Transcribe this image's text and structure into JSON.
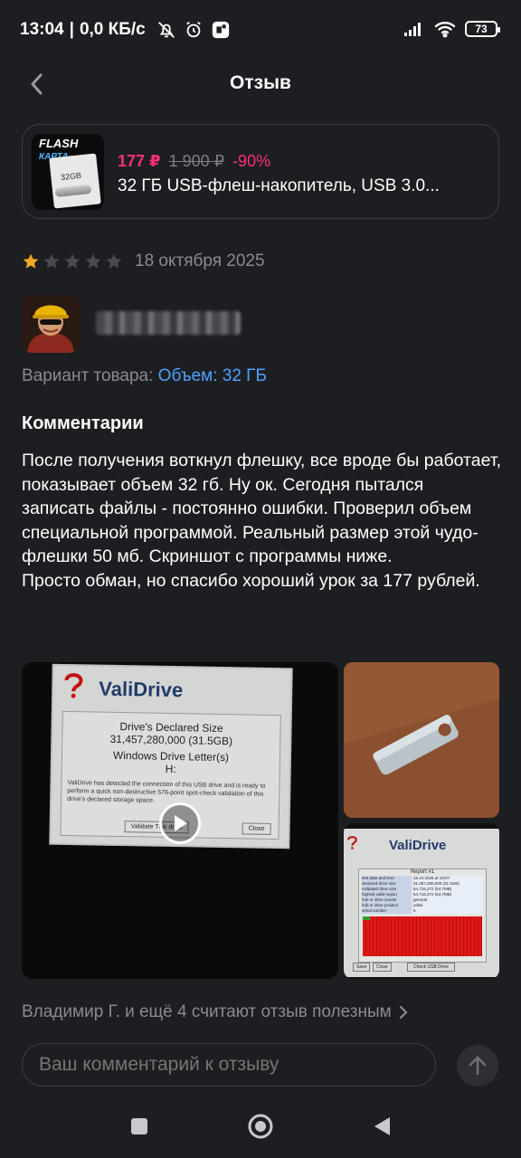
{
  "status_bar": {
    "time": "13:04",
    "speed": "0,0 КБ/с",
    "battery": "73"
  },
  "header": {
    "title": "Отзыв"
  },
  "product": {
    "thumb_brand": "FLASH",
    "thumb_sub": "КАРТА",
    "thumb_capacity": "32GB",
    "price_new": "177 ₽",
    "price_old": "1 900 ₽",
    "discount": "-90%",
    "name": "32 ГБ USB-флеш-накопитель, USB 3.0..."
  },
  "review": {
    "rating": 1,
    "max_rating": 5,
    "date": "18 октября 2025",
    "variant_label": "Вариант товара:",
    "variant_value": "Объем: 32 ГБ",
    "comments_title": "Комментарии",
    "comment_text": "После получения воткнул флешку, все вроде бы работает, показывает объем 32 гб. Ну ок. Сегодня пытался записать файлы - постоянно ошибки. Проверил объем специальной программой. Реальный размер этой чудо-флешки 50 мб. Скриншот с программы ниже.\nПросто обман, но спасибо хороший урок за 177 рублей."
  },
  "media": {
    "main": {
      "app_title": "ValiDrive",
      "declared_title": "Drive's Declared Size",
      "declared_value": "31,457,280,000 (31.5GB)",
      "letters_title": "Windows Drive Letter(s)",
      "letters_value": "H:",
      "message": "ValiDrive has detected the connection of this USB drive and is ready to perform a quick non-destructive 576-point spot-check validation of this drive's declared storage space.",
      "btn_validate": "Validate This drive",
      "btn_close": "Close"
    },
    "side2": {
      "app_title": "ValiDrive",
      "report_title": "Report #1",
      "rows": [
        {
          "k": "test date and time",
          "v": "18.10.2025  at  19:07"
        },
        {
          "k": "declared drive size",
          "v": "31,457,280,000 (31.5GB)"
        },
        {
          "k": "validated drive size",
          "v": "54,716,272 (54.7MB)"
        },
        {
          "k": "highest valid region",
          "v": "54,716,272 (54.7MB)"
        },
        {
          "k": "hub or drive vendor",
          "v": "general"
        },
        {
          "k": "hub or drive product",
          "v": "udisk"
        },
        {
          "k": "serial number",
          "v": "6"
        }
      ],
      "btn_save": "Save",
      "btn_close": "Close",
      "btn_check": "Check USB Drive"
    }
  },
  "helpful": {
    "text": "Владимир Г. и ещё 4 считают отзыв полезным"
  },
  "comment_input": {
    "placeholder": "Ваш комментарий к отзыву"
  },
  "colors": {
    "background": "#1d1e22",
    "accent_price": "#ff2d7d",
    "link_blue": "#4ea3ff",
    "star_active": "#f5a623",
    "star_inactive": "#4a4b50",
    "muted_text": "#8a8b90"
  }
}
